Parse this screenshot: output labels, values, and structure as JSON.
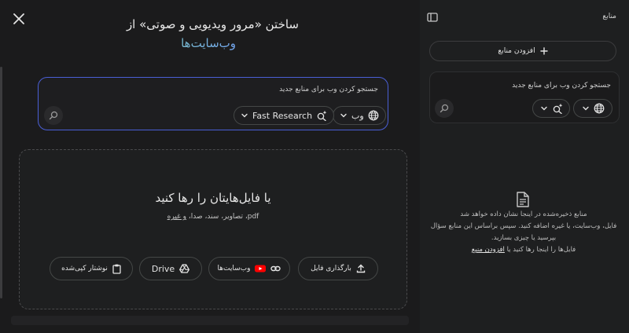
{
  "dialog": {
    "title": "ساختن «مرور ویدیویی و صوتی» از",
    "title_accent": "وب‌سایت‌ها",
    "search": {
      "placeholder": "جستجو کردن وب برای منابع جدید",
      "source_label": "وب",
      "mode_label": "Fast Research"
    },
    "dropzone": {
      "title": "یا فایل‌هایتان را رها کنید",
      "subtitle_prefix": "pdf، تصاویر، سند، صدا، ",
      "subtitle_link": "و غیره",
      "buttons": {
        "upload": "بارگذاری فایل",
        "websites": "وب‌سایت‌ها",
        "drive": "Drive",
        "clipboard": "نوشتار کپی‌شده"
      }
    }
  },
  "panel": {
    "title": "منابع",
    "add_source": "افزودن منابع",
    "search_placeholder": "جستجو کردن وب برای منابع جدید",
    "empty": {
      "line1": "منابع ذخیره‌شده در اینجا نشان داده خواهد شد",
      "line2": "فایل، وب‌سایت، یا غیره اضافه کنید. سپس براساس این منابع سؤال بپرسید یا چیزی بسازید.",
      "line3_prefix": "فایل‌ها را اینجا رها کنید یا ",
      "line3_link": "افزودن منبع"
    }
  },
  "colors": {
    "accent_border": "#4a5fd6",
    "youtube_red": "#ff0000"
  }
}
